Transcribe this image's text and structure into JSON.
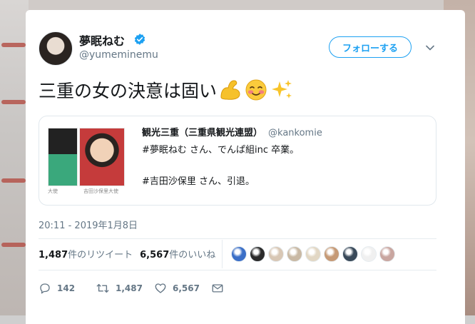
{
  "tweet": {
    "author": {
      "name": "夢眠ねむ",
      "handle": "@yumeminemu",
      "verified": true
    },
    "follow_label": "フォローする",
    "text": "三重の女の決意は固い",
    "emojis": [
      "flexed-biceps",
      "smiling-blush",
      "sparkles"
    ],
    "quote": {
      "name": "観光三重（三重県観光連盟）",
      "handle": "@kankomie",
      "lines": [
        "#夢眠ねむ さん、でんぱ組inc 卒業。",
        "",
        "#吉田沙保里 さん、引退。"
      ],
      "thumb_captions": [
        "大使",
        "吉田沙保里大使"
      ]
    },
    "timestamp": "20:11 - 2019年1月8日",
    "stats": {
      "retweets_count": "1,487",
      "retweets_label": "件のリツイート",
      "likes_count": "6,567",
      "likes_label": "件のいいね"
    },
    "actions": {
      "replies": "142",
      "retweets": "1,487",
      "likes": "6,567"
    }
  },
  "colors": {
    "accent": "#1da1f2",
    "secondary_text": "#657786",
    "primary_text": "#14171a"
  },
  "liker_avatars": [
    "#3b6fc7",
    "#2b2b2b",
    "#d8c7b5",
    "#c9b9a4",
    "#e2d7c4",
    "#c69a76",
    "#3a4a5a",
    "#f0f0f0",
    "#c9a6a0"
  ]
}
